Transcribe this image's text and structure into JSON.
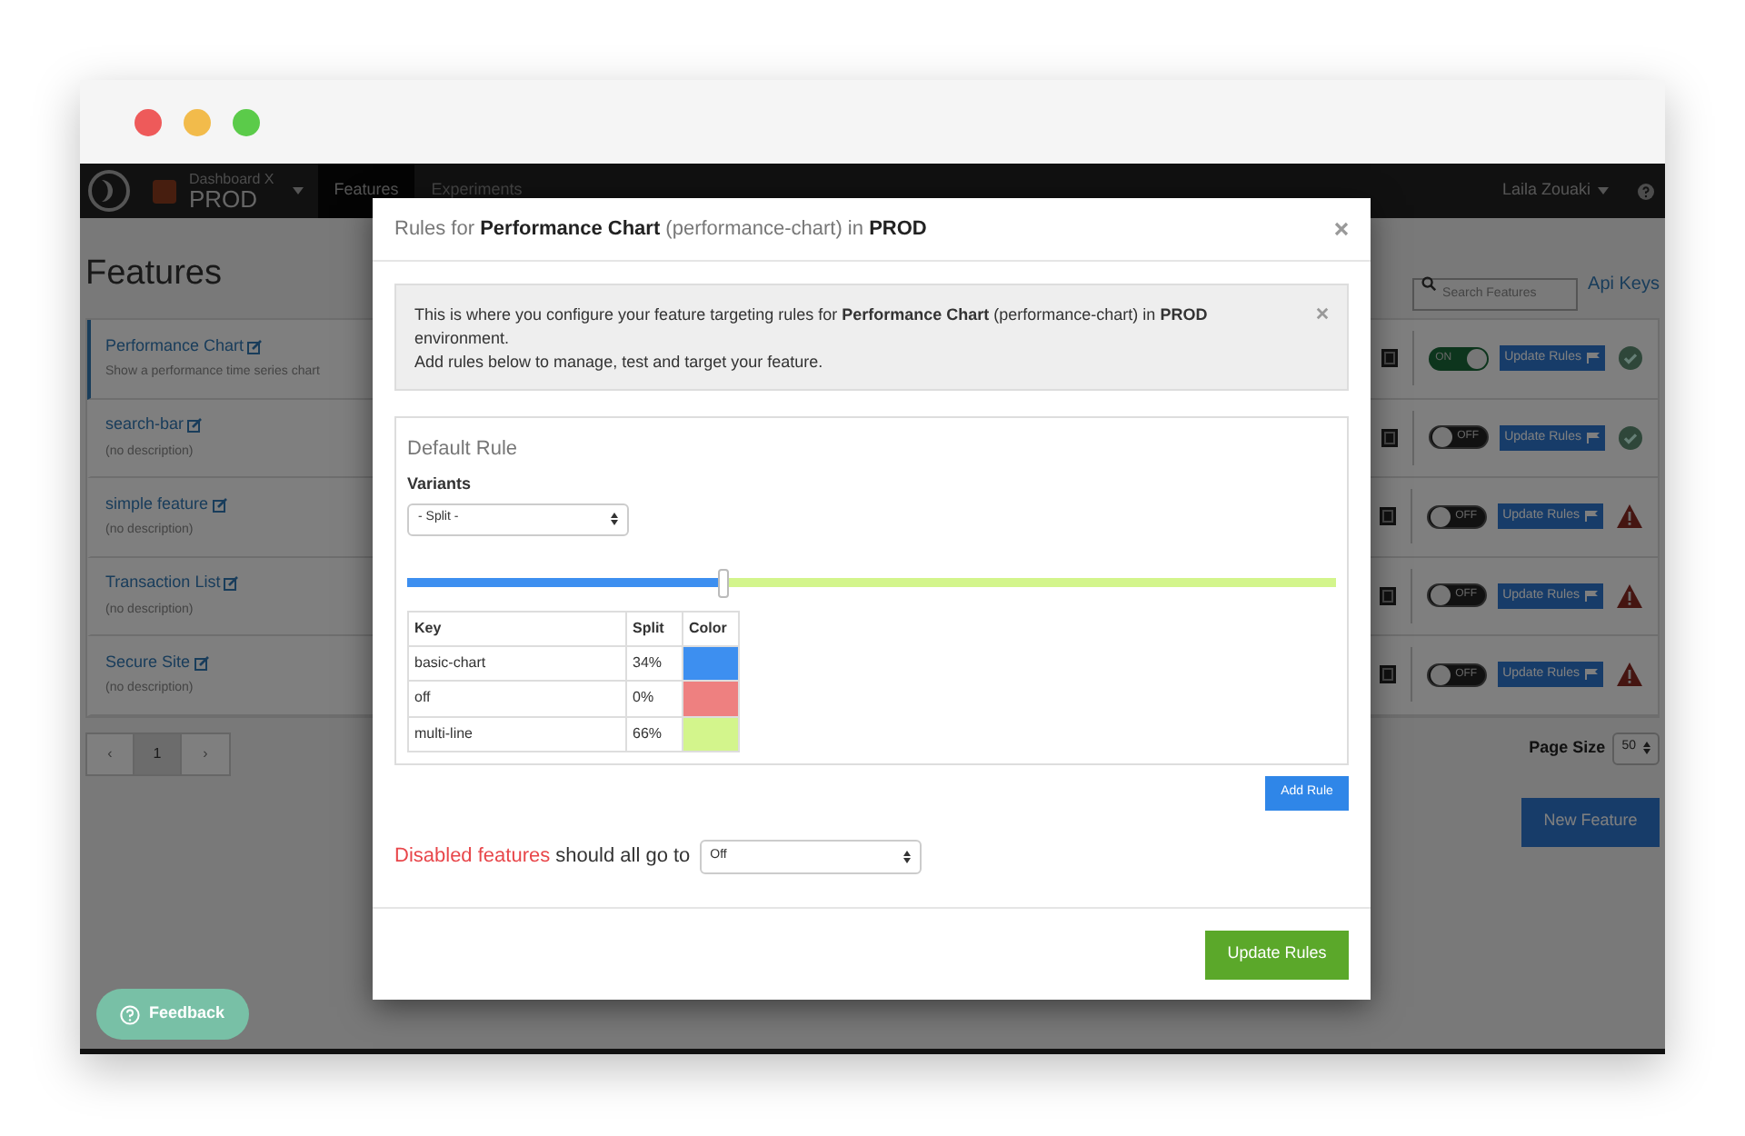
{
  "navbar": {
    "project": "Dashboard X",
    "environment": "PROD",
    "tabs": [
      {
        "label": "Features",
        "selected": true
      },
      {
        "label": "Experiments",
        "selected": false
      }
    ],
    "user": "Laila Zouaki"
  },
  "page": {
    "title": "Features",
    "search": {
      "placeholder": "Search Features"
    },
    "api_link": "Api Keys"
  },
  "features": [
    {
      "name": "Performance Chart",
      "description": "Show a performance time series chart",
      "selected": true,
      "on": true,
      "toggle_label": "ON",
      "button": "Update Rules",
      "kind": "ok"
    },
    {
      "name": "search-bar",
      "description": "(no description)",
      "selected": false,
      "on": false,
      "toggle_label": "OFF",
      "button": "Update Rules",
      "kind": "ok"
    },
    {
      "name": "simple feature",
      "description": "(no description)",
      "selected": false,
      "on": false,
      "toggle_label": "OFF",
      "button": "Update Rules",
      "kind": "warning"
    },
    {
      "name": "Transaction List",
      "description": "(no description)",
      "selected": false,
      "on": false,
      "toggle_label": "OFF",
      "button": "Update Rules",
      "kind": "warning"
    },
    {
      "name": "Secure Site",
      "description": "(no description)",
      "selected": false,
      "on": false,
      "toggle_label": "OFF",
      "button": "Update Rules",
      "kind": "warning"
    }
  ],
  "pagination": {
    "prev": "‹",
    "pages": [
      {
        "label": "1",
        "selected": true
      }
    ],
    "next": "›"
  },
  "page_size": {
    "label": "Page Size",
    "value": "50"
  },
  "new_feature_button": "New Feature",
  "feedback_button": "Feedback",
  "modal": {
    "title": "Rules for **Performance Chart** (performance-chart) in **PROD**",
    "alert": {
      "lines": [
        "This is where you configure your feature targeting rules for **Performance Chart** (performance-chart) in **PROD**",
        "environment.",
        "Add rules below to manage, test and target your feature."
      ]
    },
    "rule": {
      "title": "Default Rule",
      "variants_label": "Variants",
      "variants_value": "- Split -",
      "slider": {
        "level": 0.34
      },
      "table": {
        "columns": [
          "Key",
          "Split",
          "Color"
        ],
        "rows": [
          {
            "key": "basic-chart",
            "split": "34%",
            "color": "#3d8ff0"
          },
          {
            "key": "off",
            "split": "0%",
            "color": "#ee8080"
          },
          {
            "key": "multi-line",
            "split": "66%",
            "color": "#d3f58c"
          }
        ]
      }
    },
    "add_rule_button": "Add Rule",
    "disabled": {
      "highlight": "Disabled features",
      "rest": "should all go to",
      "value": "Off"
    },
    "update_button": "Update Rules"
  }
}
